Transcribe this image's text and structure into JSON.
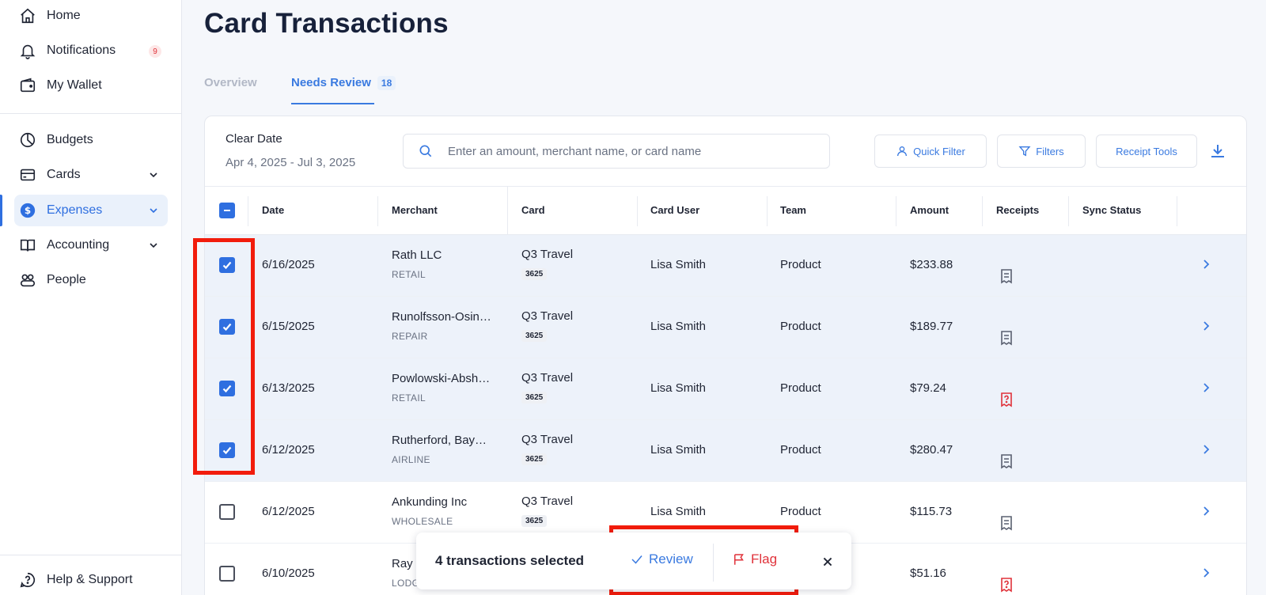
{
  "sidebar": {
    "items": [
      {
        "label": "Home",
        "icon": "home-icon"
      },
      {
        "label": "Notifications",
        "icon": "bell-icon",
        "badge": "9"
      },
      {
        "label": "My Wallet",
        "icon": "wallet-icon"
      },
      {
        "label": "Budgets",
        "icon": "pie-chart-icon"
      },
      {
        "label": "Cards",
        "icon": "credit-card-icon",
        "expandable": true
      },
      {
        "label": "Expenses",
        "icon": "dollar-icon",
        "expandable": true,
        "active": true
      },
      {
        "label": "Accounting",
        "icon": "book-icon",
        "expandable": true
      },
      {
        "label": "People",
        "icon": "people-icon"
      }
    ],
    "footer": {
      "label": "Help & Support",
      "icon": "help-chat-icon"
    }
  },
  "header": {
    "title": "Card Transactions",
    "tabs": [
      {
        "label": "Overview",
        "active": false
      },
      {
        "label": "Needs Review",
        "count": "18",
        "active": true
      }
    ]
  },
  "toolbar": {
    "clear_date_label": "Clear Date",
    "date_range": "Apr 4, 2025 - Jul 3, 2025",
    "search_placeholder": "Enter an amount, merchant name, or card name",
    "quick_filter_label": "Quick Filter",
    "filters_label": "Filters",
    "receipt_tools_label": "Receipt Tools"
  },
  "table": {
    "columns": [
      "Date",
      "Merchant",
      "Card",
      "Card User",
      "Team",
      "Amount",
      "Receipts",
      "Sync Status"
    ],
    "rows": [
      {
        "selected": true,
        "date": "6/16/2025",
        "merchant": "Rath LLC",
        "category": "RETAIL",
        "card": "Q3 Travel",
        "card_last4": "3625",
        "user": "Lisa Smith",
        "team": "Product",
        "amount": "$233.88",
        "receipt_status": "attached"
      },
      {
        "selected": true,
        "date": "6/15/2025",
        "merchant": "Runolfsson-Osin…",
        "category": "REPAIR",
        "card": "Q3 Travel",
        "card_last4": "3625",
        "user": "Lisa Smith",
        "team": "Product",
        "amount": "$189.77",
        "receipt_status": "attached"
      },
      {
        "selected": true,
        "date": "6/13/2025",
        "merchant": "Powlowski-Absh…",
        "category": "RETAIL",
        "card": "Q3 Travel",
        "card_last4": "3625",
        "user": "Lisa Smith",
        "team": "Product",
        "amount": "$79.24",
        "receipt_status": "missing"
      },
      {
        "selected": true,
        "date": "6/12/2025",
        "merchant": "Rutherford, Bay…",
        "category": "AIRLINE",
        "card": "Q3 Travel",
        "card_last4": "3625",
        "user": "Lisa Smith",
        "team": "Product",
        "amount": "$280.47",
        "receipt_status": "attached"
      },
      {
        "selected": false,
        "date": "6/12/2025",
        "merchant": "Ankunding Inc",
        "category": "WHOLESALE",
        "card": "Q3 Travel",
        "card_last4": "3625",
        "user": "Lisa Smith",
        "team": "Product",
        "amount": "$115.73",
        "receipt_status": "attached"
      },
      {
        "selected": false,
        "date": "6/10/2025",
        "merchant": "Ray",
        "category": "LODG",
        "card": "",
        "card_last4": "",
        "user": "",
        "team": "",
        "amount": "$51.16",
        "receipt_status": "missing"
      }
    ]
  },
  "selection_bar": {
    "text": "4 transactions selected",
    "review_label": "Review",
    "flag_label": "Flag"
  },
  "colors": {
    "accent": "#2f6fe0",
    "danger": "#e0323a",
    "highlight_box": "#f21c0c",
    "selected_row": "#edf2fa"
  }
}
